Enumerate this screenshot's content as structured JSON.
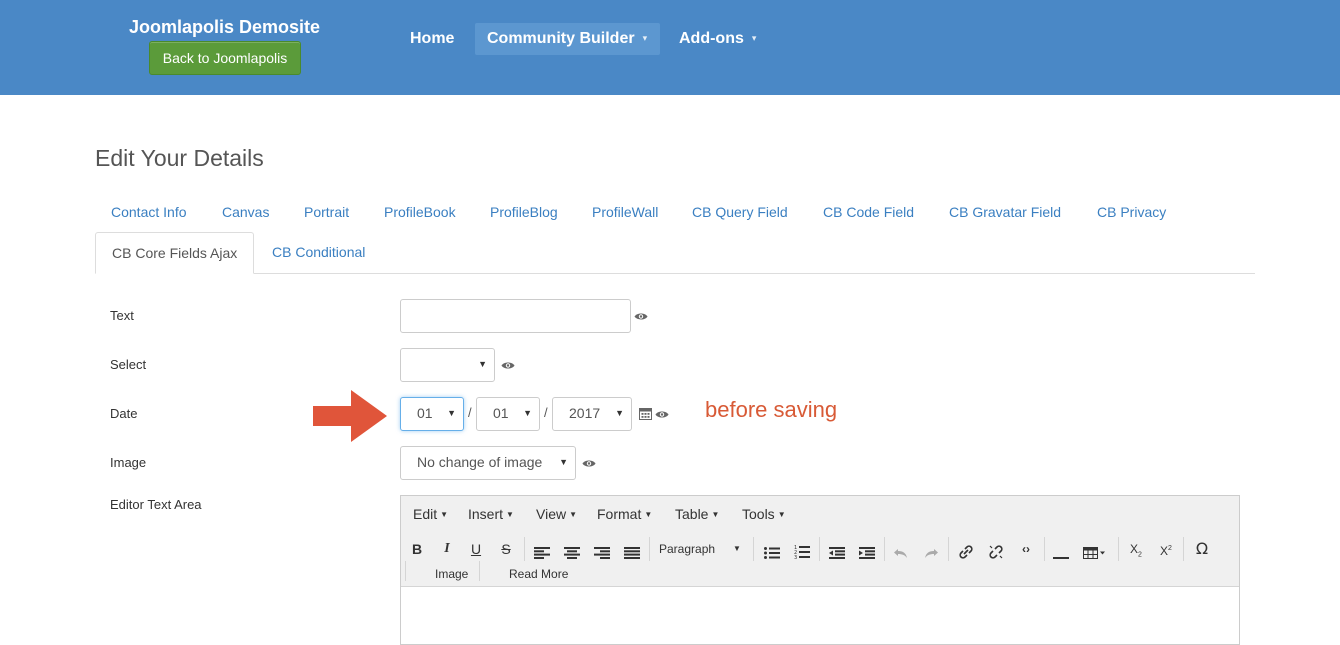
{
  "header": {
    "site_title": "Joomlapolis Demosite",
    "back_button": "Back to Joomlapolis",
    "nav": [
      {
        "label": "Home"
      },
      {
        "label": "Community Builder",
        "caret": "▾"
      },
      {
        "label": "Add-ons",
        "caret": "▾"
      }
    ]
  },
  "page": {
    "title": "Edit Your Details",
    "tabs_row1": [
      "Contact Info",
      "Canvas",
      "Portrait",
      "ProfileBook",
      "ProfileBlog",
      "ProfileWall",
      "CB Query Field",
      "CB Code Field",
      "CB Gravatar Field",
      "CB Privacy"
    ],
    "tabs_row2": [
      "CB Core Fields Ajax",
      "CB Conditional"
    ],
    "active_tab": "CB Core Fields Ajax"
  },
  "form": {
    "text_label": "Text",
    "text_value": "",
    "select_label": "Select",
    "select_value": "",
    "date_label": "Date",
    "date_day": "01",
    "date_month": "01",
    "date_year": "2017",
    "date_separator": "/",
    "image_label": "Image",
    "image_value": "No change of image",
    "editor_label": "Editor Text Area"
  },
  "annotation": {
    "text": "before saving",
    "color": "#d85a36"
  },
  "editor": {
    "menus": [
      "Edit",
      "Insert",
      "View",
      "Format",
      "Table",
      "Tools"
    ],
    "format_select": "Paragraph",
    "row2_buttons": [
      "Image",
      "Read More"
    ],
    "toolbar_icons": [
      "bold-icon",
      "italic-icon",
      "underline-icon",
      "strikethrough-icon",
      "align-left-icon",
      "align-center-icon",
      "align-right-icon",
      "align-justify-icon",
      "bullet-list-icon",
      "numbered-list-icon",
      "outdent-icon",
      "indent-icon",
      "undo-icon",
      "redo-icon",
      "link-icon",
      "unlink-icon",
      "code-icon",
      "horizontal-rule-icon",
      "table-icon",
      "subscript-icon",
      "superscript-icon",
      "special-character-icon"
    ]
  },
  "colors": {
    "header_bg": "#4a88c6",
    "active_nav_bg": "#5c97d0",
    "back_button_bg": "#5b9b3a",
    "tab_link": "#3a7fc1",
    "arrow": "#e0553a"
  }
}
